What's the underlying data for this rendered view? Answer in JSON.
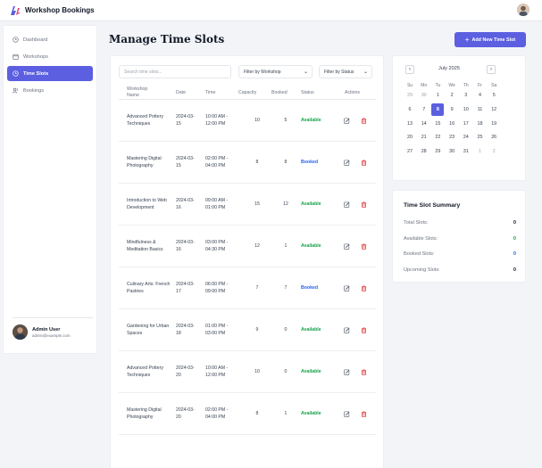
{
  "app": {
    "title": "Workshop Bookings",
    "logo_icon": "lightning-logo-icon",
    "accent": "#5b5fe0"
  },
  "sidebar": {
    "items": [
      {
        "label": "Dashboard",
        "icon": "clock-icon",
        "active": false
      },
      {
        "label": "Workshops",
        "icon": "calendar-icon",
        "active": false
      },
      {
        "label": "Time Slots",
        "icon": "clock-icon",
        "active": true
      },
      {
        "label": "Bookings",
        "icon": "users-icon",
        "active": false
      }
    ],
    "user": {
      "name": "Admin User",
      "email": "admin@example.com"
    }
  },
  "main": {
    "title": "Manage Time Slots",
    "add_button": "Add New Time Slot",
    "search_placeholder": "Search time slots...",
    "filter_workshop": "Filter by Workshop",
    "filter_status": "Filter by Status"
  },
  "table": {
    "columns": [
      "Workshop Name",
      "Date",
      "Time",
      "Capacity",
      "Booked",
      "Status",
      "Actions"
    ],
    "rows": [
      {
        "name": "Advanced Pottery Techniques",
        "date": "2024-03-15",
        "time": "10:00 AM - 12:00 PM",
        "capacity": "10",
        "booked": "5",
        "status": "Available"
      },
      {
        "name": "Mastering Digital Photography",
        "date": "2024-03-15",
        "time": "02:00 PM - 04:00 PM",
        "capacity": "8",
        "booked": "8",
        "status": "Booked"
      },
      {
        "name": "Introduction to Web Development",
        "date": "2024-03-16",
        "time": "09:00 AM - 01:00 PM",
        "capacity": "15",
        "booked": "12",
        "status": "Available"
      },
      {
        "name": "Mindfulness & Meditation Basics",
        "date": "2024-03-16",
        "time": "03:00 PM - 04:30 PM",
        "capacity": "12",
        "booked": "1",
        "status": "Available"
      },
      {
        "name": "Culinary Arts: French Pastries",
        "date": "2024-03-17",
        "time": "06:00 PM - 09:00 PM",
        "capacity": "7",
        "booked": "7",
        "status": "Booked"
      },
      {
        "name": "Gardening for Urban Spaces",
        "date": "2024-03-18",
        "time": "01:00 PM - 03:00 PM",
        "capacity": "9",
        "booked": "0",
        "status": "Available"
      },
      {
        "name": "Advanced Pottery Techniques",
        "date": "2024-03-20",
        "time": "10:00 AM - 12:00 PM",
        "capacity": "10",
        "booked": "0",
        "status": "Available"
      },
      {
        "name": "Mastering Digital Photography",
        "date": "2024-03-20",
        "time": "02:00 PM - 04:00 PM",
        "capacity": "8",
        "booked": "1",
        "status": "Available"
      }
    ]
  },
  "calendar": {
    "month": "July 2025",
    "prev_icon": "chevron-left-icon",
    "next_icon": "chevron-right-icon",
    "dow": [
      "Su",
      "Mo",
      "Tu",
      "We",
      "Th",
      "Fr",
      "Sa"
    ],
    "days": [
      [
        "29",
        "30",
        "1",
        "2",
        "3",
        "4",
        "5"
      ],
      [
        "6",
        "7",
        "8",
        "9",
        "10",
        "11",
        "12"
      ],
      [
        "13",
        "14",
        "15",
        "16",
        "17",
        "18",
        "19"
      ],
      [
        "20",
        "21",
        "22",
        "23",
        "24",
        "25",
        "26"
      ],
      [
        "27",
        "28",
        "29",
        "30",
        "31",
        "1",
        "2"
      ]
    ],
    "selected": "8"
  },
  "summary": {
    "title": "Time Slot Summary",
    "items": [
      {
        "label": "Total Slots:",
        "value": "0",
        "color": "#111827"
      },
      {
        "label": "Available Slots:",
        "value": "0",
        "color": "#16a34a"
      },
      {
        "label": "Booked Slots:",
        "value": "0",
        "color": "#2563eb"
      },
      {
        "label": "Upcoming Slots:",
        "value": "0",
        "color": "#111827"
      }
    ]
  }
}
